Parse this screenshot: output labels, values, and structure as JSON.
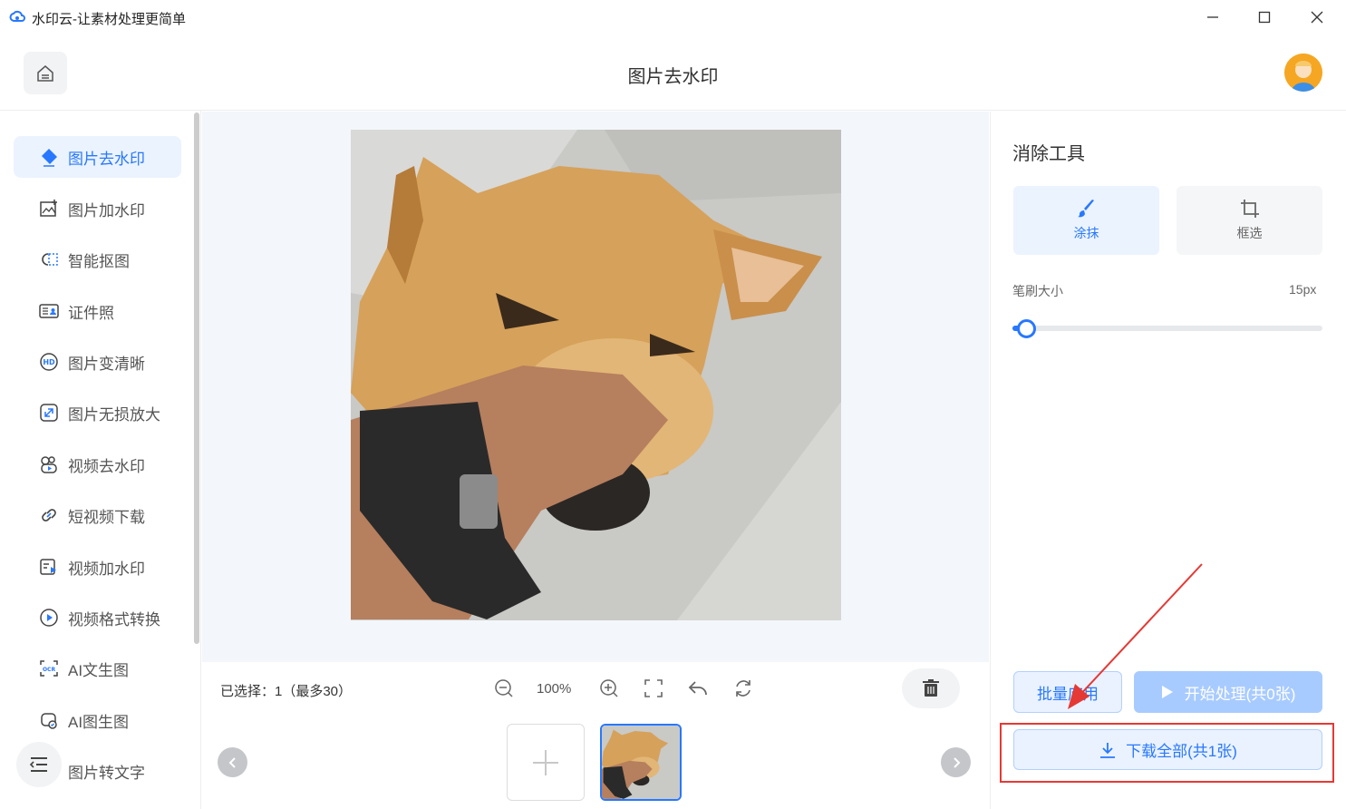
{
  "window": {
    "title": "水印云-让素材处理更简单"
  },
  "header": {
    "title": "图片去水印"
  },
  "sidebar": {
    "items": [
      {
        "label": "图片去水印",
        "icon": "eraser-icon",
        "active": true
      },
      {
        "label": "图片加水印",
        "icon": "image-add-icon",
        "active": false
      },
      {
        "label": "智能抠图",
        "icon": "cutout-icon",
        "active": false
      },
      {
        "label": "证件照",
        "icon": "id-card-icon",
        "active": false
      },
      {
        "label": "图片变清晰",
        "icon": "hd-icon",
        "active": false
      },
      {
        "label": "图片无损放大",
        "icon": "enlarge-icon",
        "active": false
      },
      {
        "label": "视频去水印",
        "icon": "video-eraser-icon",
        "active": false
      },
      {
        "label": "短视频下载",
        "icon": "link-icon",
        "active": false
      },
      {
        "label": "视频加水印",
        "icon": "video-add-icon",
        "active": false
      },
      {
        "label": "视频格式转换",
        "icon": "play-circle-icon",
        "active": false
      },
      {
        "label": "AI文生图",
        "icon": "ocr-icon",
        "active": false
      },
      {
        "label": "AI图生图",
        "icon": "ai-image-icon",
        "active": false
      },
      {
        "label": "图片转文字",
        "icon": "text-icon",
        "active": false
      }
    ]
  },
  "editor": {
    "selected_text": "已选择：1（最多30）",
    "zoom": "100%"
  },
  "tools": {
    "title": "消除工具",
    "smear_label": "涂抹",
    "box_label": "框选",
    "brush_label": "笔刷大小",
    "brush_value": "15px",
    "brush_level_fraction": 0.04
  },
  "actions": {
    "batch_label": "批量应用",
    "start_label": "开始处理(共0张)",
    "download_label": "下载全部(共1张)"
  },
  "colors": {
    "accent": "#2878ff",
    "highlight": "#e53935"
  }
}
